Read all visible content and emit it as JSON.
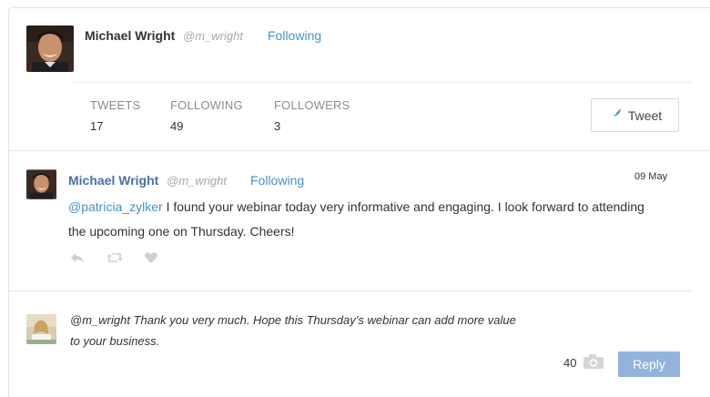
{
  "profile": {
    "name": "Michael Wright",
    "handle": "@m_wright",
    "follow_status": "Following",
    "stats": [
      {
        "label": "TWEETS",
        "value": "17"
      },
      {
        "label": "FOLLOWING",
        "value": "49"
      },
      {
        "label": "FOLLOWERS",
        "value": "3"
      }
    ],
    "tweet_button": "Tweet"
  },
  "post": {
    "name": "Michael Wright",
    "handle": "@m_wright",
    "follow_status": "Following",
    "date": "09 May",
    "mention": "@patricia_zylker",
    "text": " I found your webinar today very informative and engaging. I look forward to attending the upcoming one on Thursday. Cheers!",
    "actions": [
      "reply-icon",
      "retweet-icon",
      "heart-icon"
    ]
  },
  "reply": {
    "text": "@m_wright Thank you very much. Hope this Thursday’s webinar can add more value to your business.",
    "char_count": "40",
    "button": "Reply"
  },
  "colors": {
    "link": "#4a90c9",
    "name_link": "#4a6fa5",
    "reply_button": "#93b3dd"
  }
}
